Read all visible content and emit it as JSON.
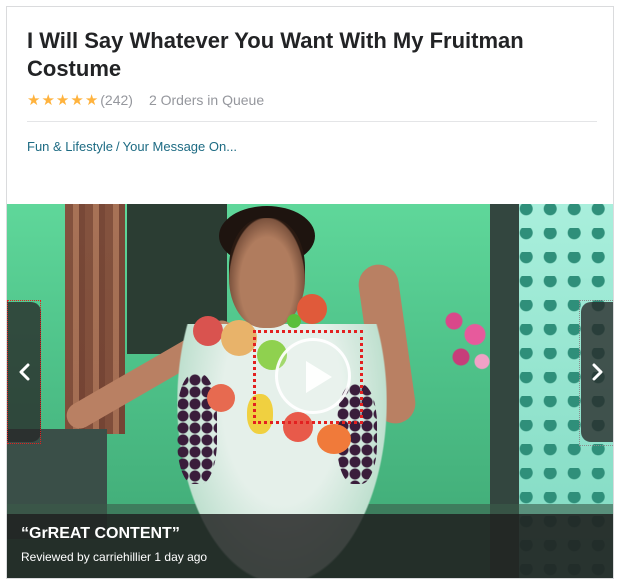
{
  "gig": {
    "title": "I Will Say Whatever You Want With My Fruitman Costume",
    "rating_count": "(242)",
    "stars": 5,
    "queue_text": "2 Orders in Queue"
  },
  "breadcrumb": {
    "category": "Fun & Lifestyle",
    "separator": "/",
    "subcategory": "Your Message On..."
  },
  "media": {
    "review_quote": "“GrREAT CONTENT”",
    "review_meta": "Reviewed by carriehillier 1 day ago"
  },
  "icons": {
    "star": "star-icon",
    "play": "play-icon",
    "prev": "chevron-left-icon",
    "next": "chevron-right-icon"
  },
  "colors": {
    "star": "#ffb33e",
    "link": "#1d6b83",
    "title": "#222325",
    "muted": "#95979d"
  }
}
